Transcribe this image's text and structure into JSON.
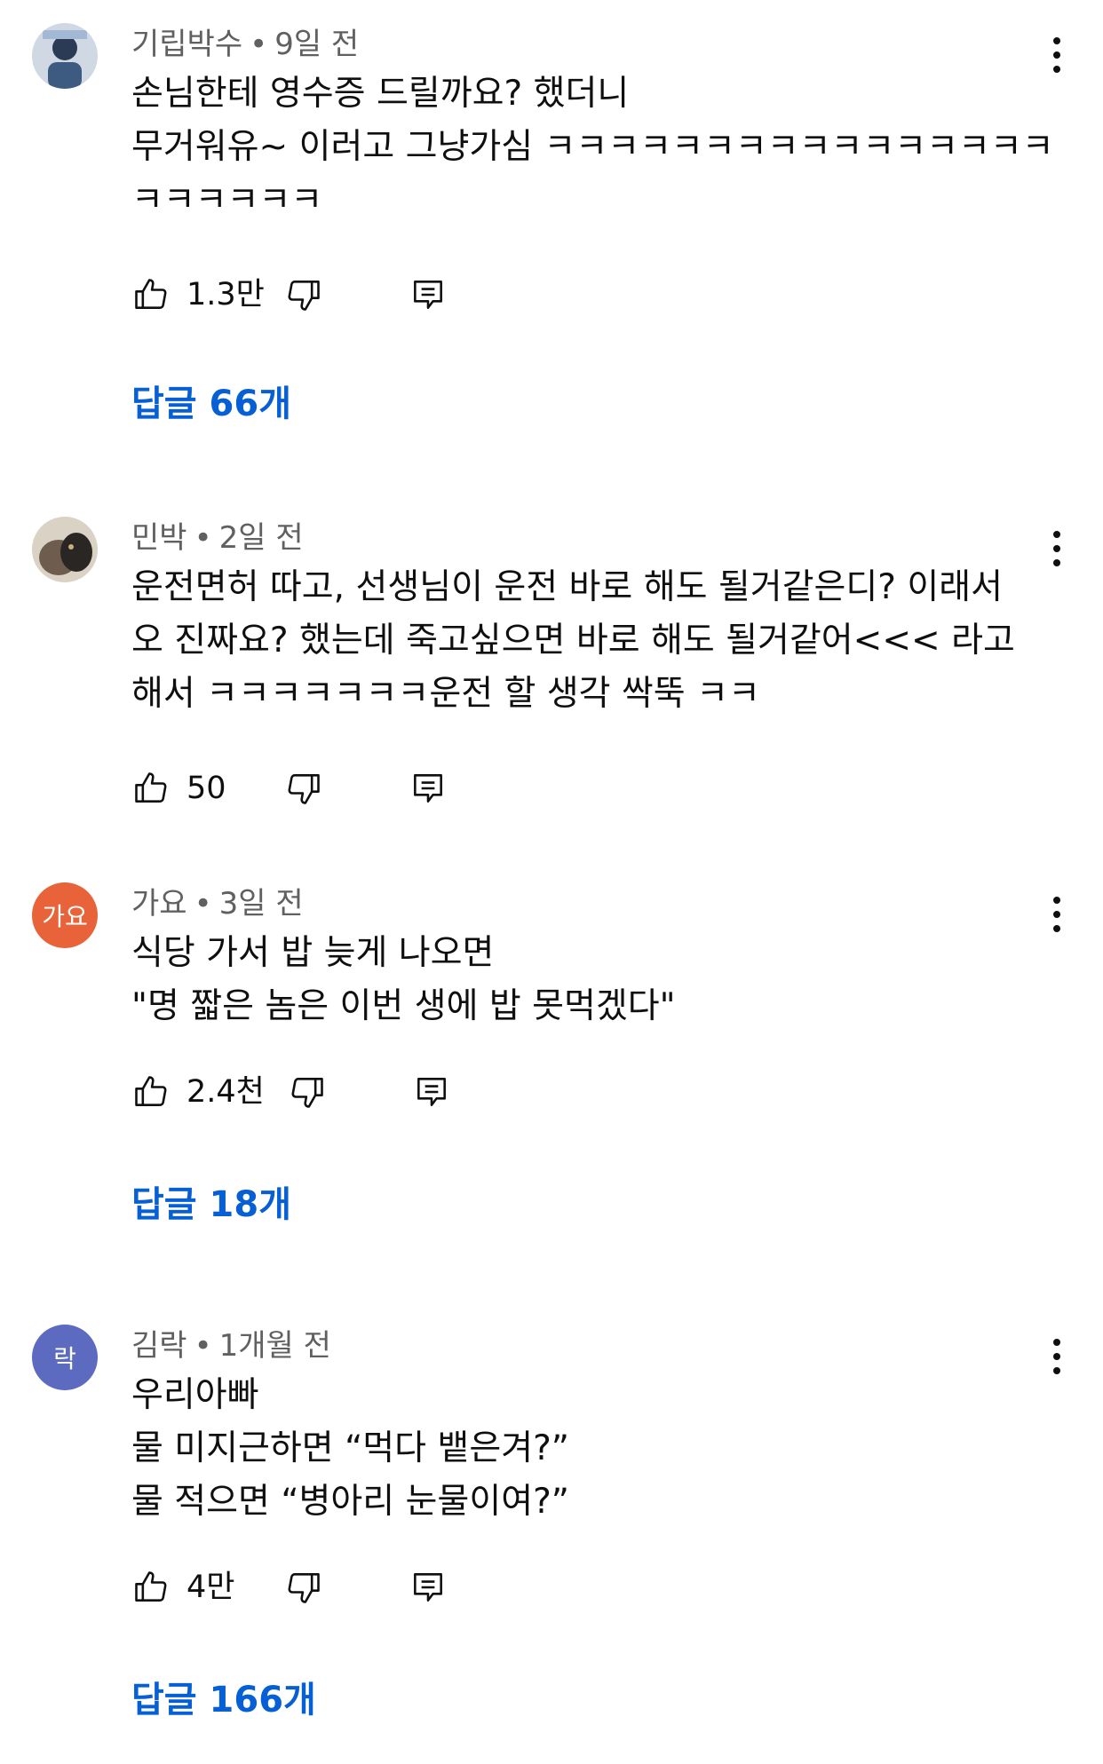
{
  "comments": [
    {
      "author": "기립박수",
      "time": "9일 전",
      "lines": [
        "손님한테 영수증 드릴까요? 했더니",
        "무거워유~ 이러고 그냥가심 ㅋㅋㅋㅋㅋㅋㅋㅋㅋㅋㅋㅋㅋㅋㅋㅋ",
        "ㅋㅋㅋㅋㅋㅋ"
      ],
      "likes": "1.3만",
      "replies": "답글 66개",
      "avatar_text": "",
      "avatar_color": "#5a7fa8"
    },
    {
      "author": "민박",
      "time": "2일 전",
      "lines": [
        "운전면허 따고, 선생님이 운전 바로 해도 될거같은디? 이래서",
        "오 진짜요? 했는데 죽고싶으면 바로 해도 될거같어<<< 라고",
        "해서 ㅋㅋㅋㅋㅋㅋㅋ운전 할 생각 싹뚝 ㅋㅋ"
      ],
      "likes": "50",
      "replies": "",
      "avatar_text": "",
      "avatar_color": "#8a7a6a"
    },
    {
      "author": "가요",
      "time": "3일 전",
      "lines": [
        "식당 가서 밥 늦게 나오면",
        "\"명 짧은 놈은 이번 생에 밥 못먹겠다\""
      ],
      "likes": "2.4천",
      "replies": "답글 18개",
      "avatar_text": "가요",
      "avatar_color": "#e8633a"
    },
    {
      "author": "김락",
      "time": "1개월 전",
      "lines": [
        "우리아빠",
        "물 미지근하면 “먹다 뱉은겨?”",
        "물 적으면 “병아리 눈물이여?”"
      ],
      "likes": "4만",
      "replies": "답글 166개",
      "avatar_text": "락",
      "avatar_color": "#5c6bc0"
    }
  ]
}
